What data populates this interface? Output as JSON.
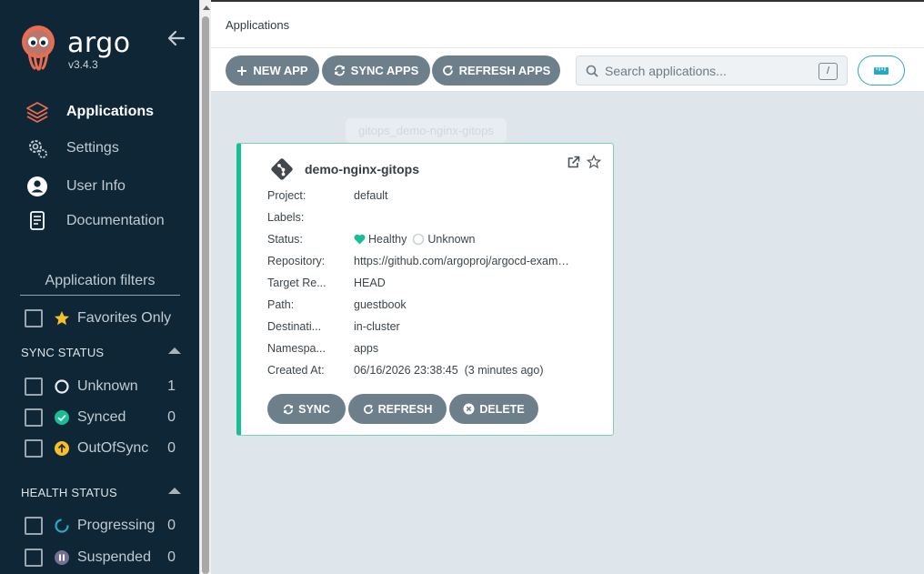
{
  "brand": {
    "name": "argo",
    "version": "v3.4.3"
  },
  "nav": [
    {
      "label": "Applications",
      "icon": "layers-icon",
      "active": true
    },
    {
      "label": "Settings",
      "icon": "gears-icon",
      "active": false
    },
    {
      "label": "User Info",
      "icon": "user-circle-icon",
      "active": false
    },
    {
      "label": "Documentation",
      "icon": "book-icon",
      "active": false
    }
  ],
  "filters": {
    "title": "Application filters",
    "favorites_label": "Favorites Only",
    "sync_status": {
      "heading": "SYNC STATUS",
      "items": [
        {
          "label": "Unknown",
          "count": "1"
        },
        {
          "label": "Synced",
          "count": "0"
        },
        {
          "label": "OutOfSync",
          "count": "0"
        }
      ]
    },
    "health_status": {
      "heading": "HEALTH STATUS",
      "items": [
        {
          "label": "Progressing",
          "count": "0"
        },
        {
          "label": "Suspended",
          "count": "0"
        }
      ]
    }
  },
  "header": {
    "breadcrumb": "Applications"
  },
  "toolbar": {
    "new_app": "NEW APP",
    "sync_apps": "SYNC APPS",
    "refresh_apps": "REFRESH APPS",
    "search_placeholder": "Search applications...",
    "search_shortcut": "/"
  },
  "ghost_label": "gitops_demo-nginx-gitops",
  "app": {
    "name": "demo-nginx-gitops",
    "fields": [
      {
        "key": "Project:",
        "value": "default"
      },
      {
        "key": "Labels:",
        "value": ""
      },
      {
        "key": "Status:",
        "value": ""
      },
      {
        "key": "Repository:",
        "value": "https://github.com/argoproj/argocd-exam…"
      },
      {
        "key": "Target Re...",
        "value": "HEAD"
      },
      {
        "key": "Path:",
        "value": "guestbook"
      },
      {
        "key": "Destinati...",
        "value": "in-cluster"
      },
      {
        "key": "Namespa...",
        "value": "apps"
      },
      {
        "key": "Created At:",
        "value": "06/16/2026 23:38:45  (3 minutes ago)"
      }
    ],
    "health": "Healthy",
    "sync": "Unknown",
    "buttons": {
      "sync": "SYNC",
      "refresh": "REFRESH",
      "delete": "DELETE"
    }
  },
  "colors": {
    "sidebar_bg": "#0e2635",
    "button_bg": "#6d7f8b",
    "healthy": "#18be94",
    "accent": "#25a9c6",
    "outofsync": "#f4c030",
    "suspended": "#766f94"
  }
}
